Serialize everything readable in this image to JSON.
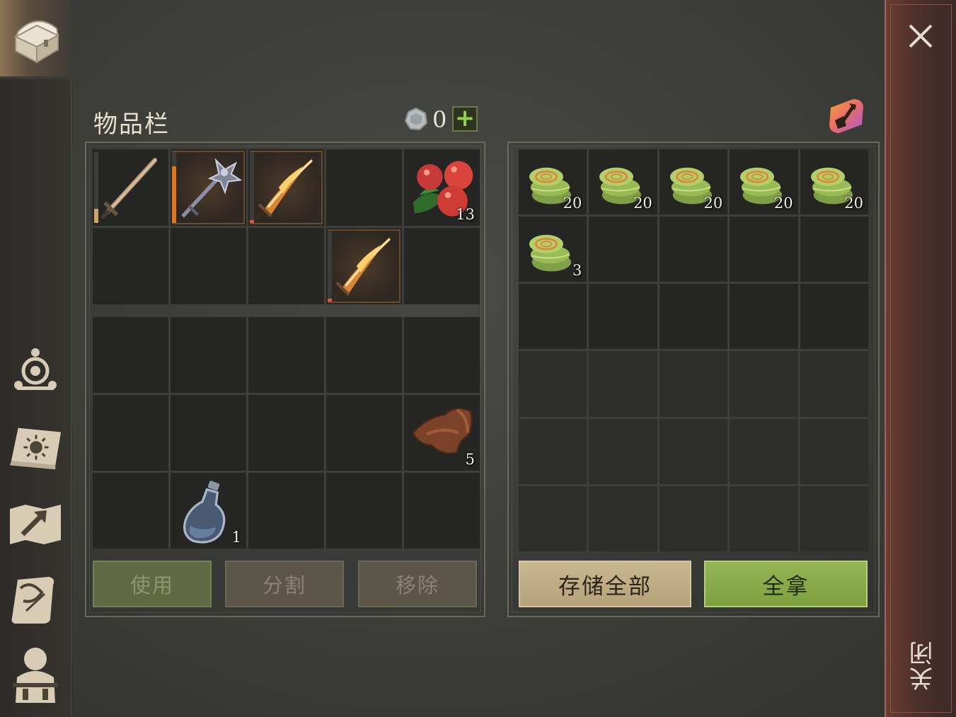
{
  "inventory": {
    "title": "物品栏",
    "currency_value": "0",
    "equipped_slots": [
      {
        "item": "wooden-sword",
        "durability": 0.2,
        "durability_color": "#c9a56b"
      },
      {
        "item": "iron-mace-staff",
        "durability": 0.8,
        "durability_color": "#e0761c"
      },
      {
        "item": "flame-sword",
        "durability": 0.04,
        "durability_color": "#e05a3a"
      },
      {
        "item": "empty"
      },
      {
        "item": "berries",
        "qty": "13"
      },
      {
        "item": "empty"
      },
      {
        "item": "empty"
      },
      {
        "item": "empty"
      },
      {
        "item": "flame-sword",
        "durability": 0.04,
        "durability_color": "#e05a3a"
      },
      {
        "item": "empty"
      }
    ],
    "bag_slots": [
      {
        "item": "empty"
      },
      {
        "item": "empty"
      },
      {
        "item": "empty"
      },
      {
        "item": "empty"
      },
      {
        "item": "empty"
      },
      {
        "item": "empty"
      },
      {
        "item": "empty"
      },
      {
        "item": "empty"
      },
      {
        "item": "empty"
      },
      {
        "item": "leather",
        "qty": "5"
      },
      {
        "item": "empty"
      },
      {
        "item": "water-bottle",
        "qty": "1"
      },
      {
        "item": "empty"
      },
      {
        "item": "empty"
      },
      {
        "item": "empty"
      }
    ],
    "buttons": {
      "use": "使用",
      "split": "分割",
      "remove": "移除"
    }
  },
  "container": {
    "slots": [
      {
        "item": "plant-fiber",
        "qty": "20"
      },
      {
        "item": "plant-fiber",
        "qty": "20"
      },
      {
        "item": "plant-fiber",
        "qty": "20"
      },
      {
        "item": "plant-fiber",
        "qty": "20"
      },
      {
        "item": "plant-fiber",
        "qty": "20"
      },
      {
        "item": "plant-fiber",
        "qty": "3"
      },
      {
        "item": "empty"
      },
      {
        "item": "empty"
      },
      {
        "item": "empty"
      },
      {
        "item": "empty"
      },
      {
        "item": "empty"
      },
      {
        "item": "empty"
      },
      {
        "item": "empty"
      },
      {
        "item": "empty"
      },
      {
        "item": "empty"
      },
      {
        "item": "locked"
      },
      {
        "item": "locked"
      },
      {
        "item": "locked"
      },
      {
        "item": "locked"
      },
      {
        "item": "locked"
      },
      {
        "item": "locked"
      },
      {
        "item": "locked"
      },
      {
        "item": "locked"
      },
      {
        "item": "locked"
      },
      {
        "item": "locked"
      },
      {
        "item": "locked"
      },
      {
        "item": "locked"
      },
      {
        "item": "locked"
      },
      {
        "item": "locked"
      },
      {
        "item": "locked"
      }
    ],
    "buttons": {
      "store_all": "存储全部",
      "take_all": "全拿"
    }
  },
  "close_label": "关闭",
  "sidebar_icons": [
    "chest-icon",
    "skills-icon",
    "journal-icon",
    "map-icon",
    "quest-scroll-icon",
    "character-icon"
  ],
  "colors": {
    "accent_green": "#8fd14a",
    "take_button": "#93b553",
    "store_button": "#c9b78f",
    "close_bar": "#6b3c32"
  }
}
